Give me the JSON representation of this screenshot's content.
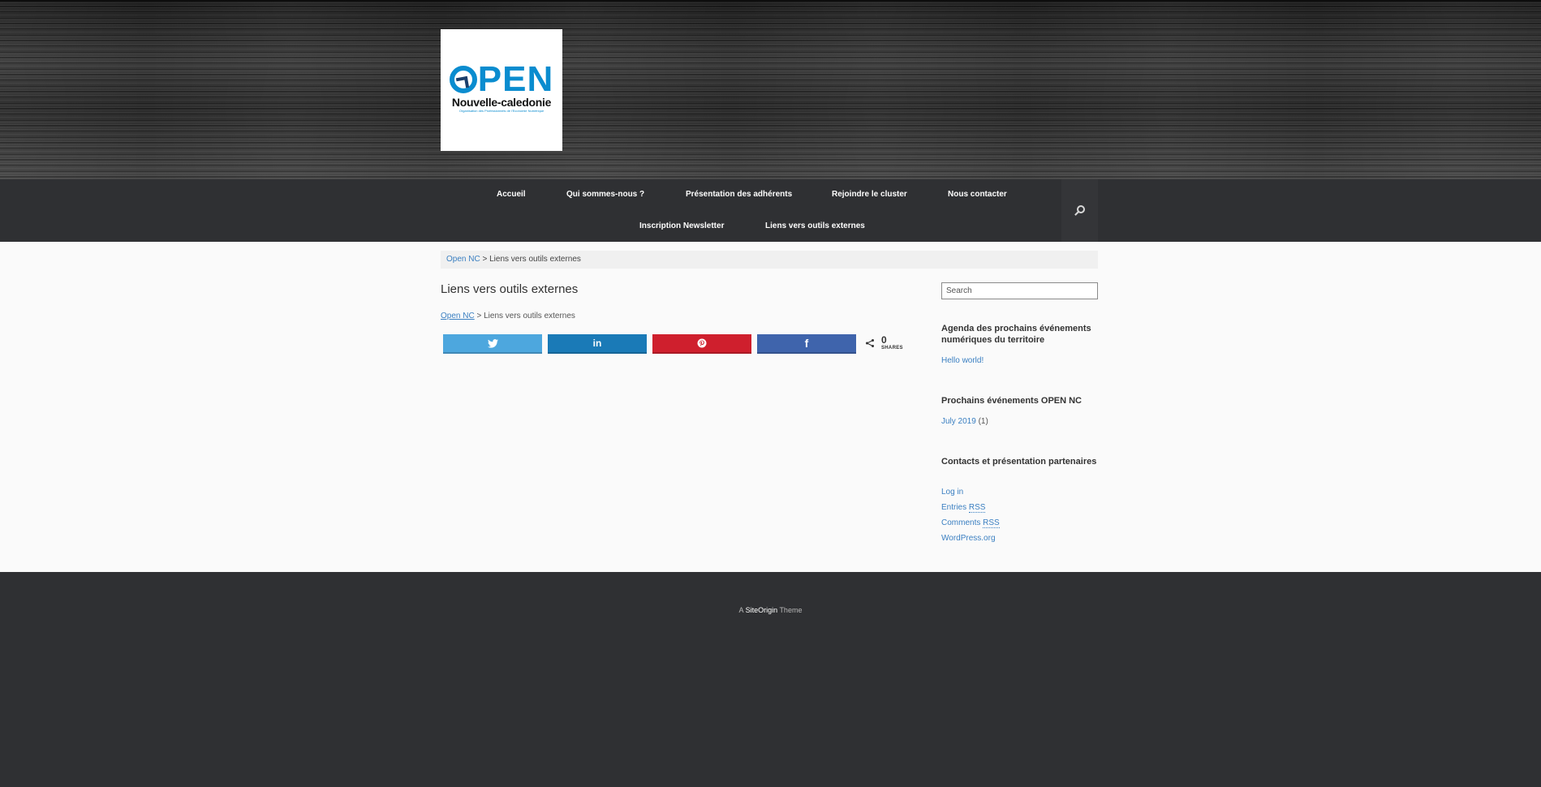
{
  "header": {
    "logo": {
      "word": "PEN",
      "first_letter": "O",
      "subtitle": "Nouvelle-caledonie",
      "tagline": "Organisation des Professionnels de l'Economie Numérique"
    }
  },
  "nav": {
    "items": [
      {
        "label": "Accueil"
      },
      {
        "label": "Qui sommes-nous ?"
      },
      {
        "label": "Présentation des adhérents"
      },
      {
        "label": "Rejoindre le cluster"
      },
      {
        "label": "Nous contacter"
      },
      {
        "label": "Inscription Newsletter"
      },
      {
        "label": "Liens vers outils externes"
      }
    ],
    "search_icon": "search-icon"
  },
  "breadcrumb": {
    "home": "Open NC",
    "separator": ">",
    "current": "Liens vers outils externes"
  },
  "page": {
    "title": "Liens vers outils externes"
  },
  "share": {
    "buttons": [
      {
        "network": "twitter",
        "icon": "twitter-icon",
        "glyph": "🐦",
        "color": "#4da7de"
      },
      {
        "network": "linkedin",
        "icon": "linkedin-icon",
        "glyph": "in",
        "color": "#1a7ab7"
      },
      {
        "network": "pinterest",
        "icon": "pinterest-icon",
        "glyph": "Ⓟ",
        "color": "#cf1f2d"
      },
      {
        "network": "facebook",
        "icon": "facebook-icon",
        "glyph": "f",
        "color": "#3f64ac"
      }
    ],
    "count": "0",
    "count_label": "SHARES"
  },
  "sidebar": {
    "search_placeholder": "Search",
    "widgets": [
      {
        "title": "Agenda des prochains événements numériques du territoire",
        "links": [
          {
            "label": "Hello world!"
          }
        ]
      },
      {
        "title": "Prochains événements OPEN NC",
        "links": [
          {
            "label": "July 2019",
            "count": "(1)"
          }
        ]
      },
      {
        "title": "Contacts et présentation partenaires",
        "links": [
          {
            "label": "Log in"
          },
          {
            "label": "Entries",
            "abbr": "RSS"
          },
          {
            "label": "Comments",
            "abbr": "RSS"
          },
          {
            "label": "WordPress.org"
          }
        ]
      }
    ]
  },
  "footer": {
    "prefix": "A",
    "brand": "SiteOrigin",
    "suffix": "Theme"
  },
  "colors": {
    "header_bg": "#2a2a2a",
    "nav_bg": "#2f3033",
    "content_bg": "#fafafa",
    "link": "#3a7fc1",
    "logo_blue": "#0a8ccf"
  }
}
